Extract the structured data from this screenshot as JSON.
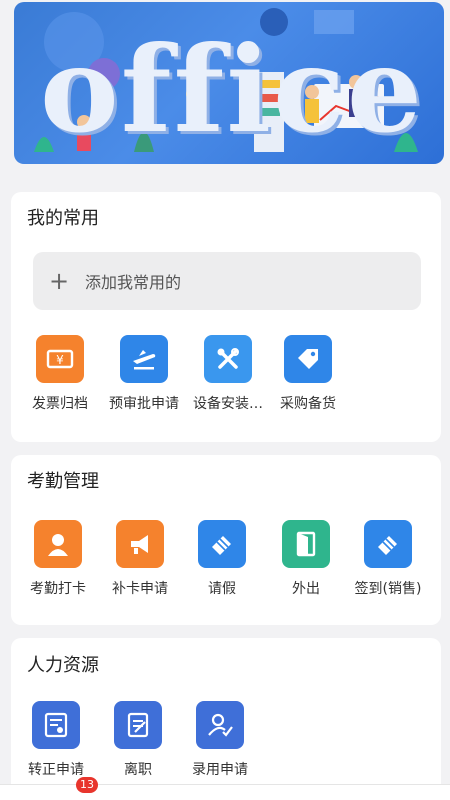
{
  "banner": {
    "word": "office"
  },
  "favorites": {
    "title": "我的常用",
    "add_label": "添加我常用的",
    "items": [
      {
        "label": "发票归档",
        "icon": "receipt-icon",
        "color": "#f5822d"
      },
      {
        "label": "预审批申请",
        "icon": "airplane-icon",
        "color": "#2f86e8"
      },
      {
        "label": "设备安装…",
        "icon": "tools-icon",
        "color": "#3a97ee"
      },
      {
        "label": "采购备货",
        "icon": "tag-icon",
        "color": "#2f86e8"
      }
    ]
  },
  "attendance": {
    "title": "考勤管理",
    "items": [
      {
        "label": "考勤打卡",
        "icon": "person-icon",
        "color": "#f5822d"
      },
      {
        "label": "补卡申请",
        "icon": "megaphone-icon",
        "color": "#f5822d"
      },
      {
        "label": "请假",
        "icon": "eraser-icon",
        "color": "#2f86e8"
      },
      {
        "label": "外出",
        "icon": "door-icon",
        "color": "#2fb58d"
      },
      {
        "label": "签到(销售)",
        "icon": "eraser-icon",
        "color": "#2f86e8"
      }
    ]
  },
  "hr": {
    "title": "人力资源",
    "items": [
      {
        "label": "转正申请",
        "icon": "profile-card-icon",
        "color": "#3f6fd8"
      },
      {
        "label": "离职",
        "icon": "document-icon",
        "color": "#3f6fd8"
      },
      {
        "label": "录用申请",
        "icon": "user-check-icon",
        "color": "#3f6fd8"
      }
    ]
  },
  "tabbar": {
    "badge": "13"
  }
}
